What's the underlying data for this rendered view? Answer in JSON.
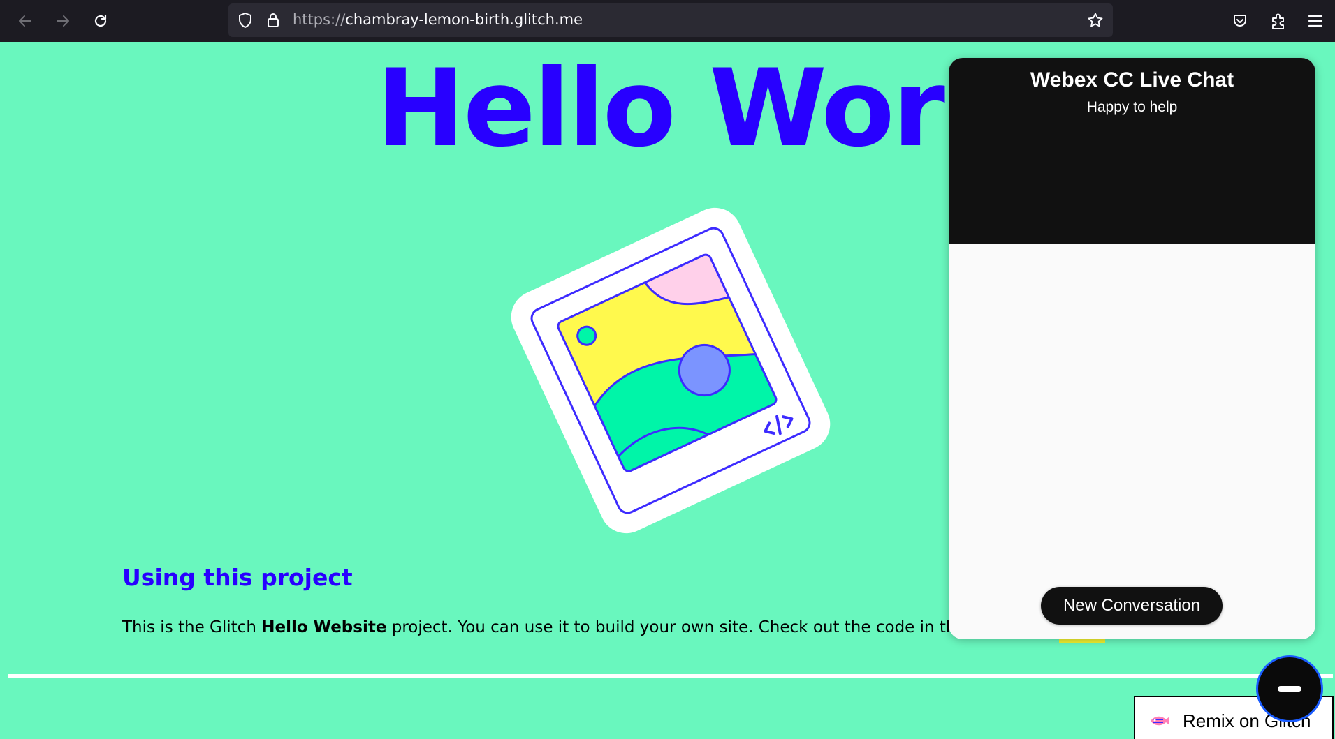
{
  "browser": {
    "url_scheme": "https://",
    "url_host": "chambray-lemon-birth.glitch.me",
    "icons": [
      "back-arrow-icon",
      "forward-arrow-icon",
      "reload-icon",
      "shield-icon",
      "lock-icon",
      "star-icon",
      "pocket-icon",
      "extensions-icon",
      "menu-icon"
    ]
  },
  "page": {
    "title": "Hello World!",
    "section_title": "Using this project",
    "body_prefix": "This is the Glitch ",
    "body_bold": "Hello Website",
    "body_suffix": " project. You can use it to build your own site. Check out the code in the editor",
    "colors": {
      "background": "#69f7be",
      "accent": "#2800ff"
    }
  },
  "chat": {
    "title": "Webex CC Live Chat",
    "subtitle": "Happy to help",
    "new_conversation_label": "New Conversation",
    "launcher_icon": "minimize-icon"
  },
  "remix": {
    "label": "Remix on Glitch",
    "icon": "glitch-fish-icon"
  }
}
